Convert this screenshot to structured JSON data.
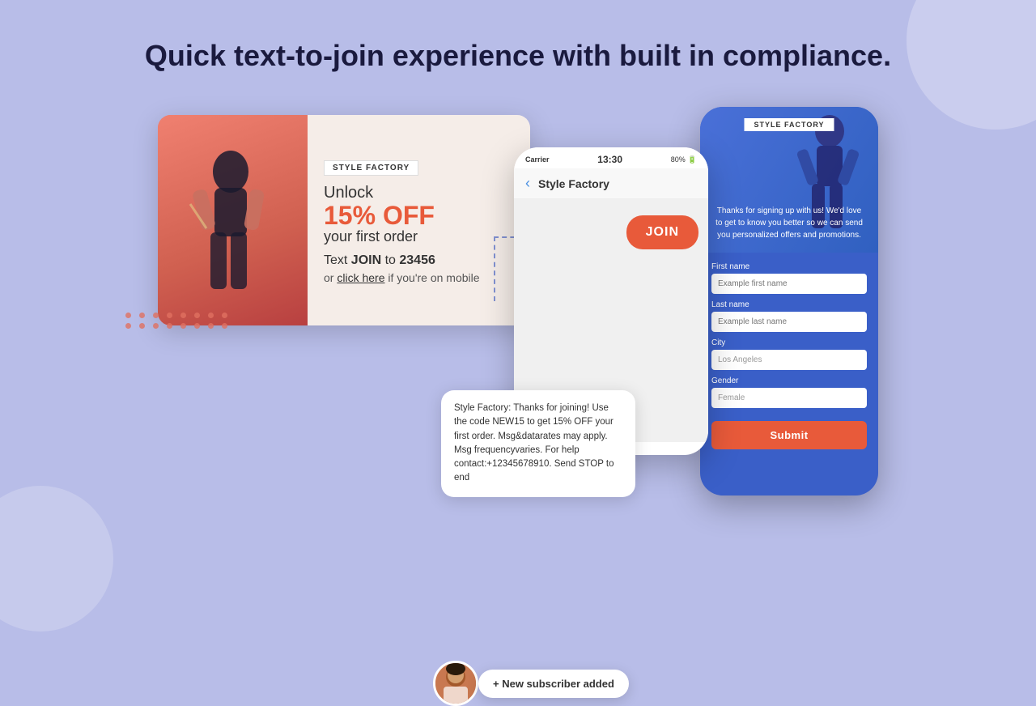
{
  "page": {
    "title": "Quick text-to-join experience with built in compliance."
  },
  "promo_card": {
    "brand": "STYLE FACTORY",
    "unlock_label": "Unlock",
    "discount": "15% OFF",
    "order_label": "your first order",
    "text_join_line": "Text JOIN to 23456",
    "mobile_line_pre": "or ",
    "click_here": "click here",
    "mobile_line_post": " if you're on mobile"
  },
  "phone": {
    "carrier": "Carrier",
    "time": "13:30",
    "battery": "80%",
    "title": "Style Factory",
    "join_button": "JOIN",
    "sms_message": "Style Factory: Thanks for joining! Use the code NEW15 to get 15% OFF your first order. Msg&datarates may apply. Msg frequencyvaries. For help contact:+12345678910. Send STOP to end"
  },
  "form_phone": {
    "brand": "STYLE FACTORY",
    "welcome_text": "Thanks for signing up with us! We'd love to get to know you better so we can send you personalized offers and promotions.",
    "fields": [
      {
        "label": "First name",
        "placeholder": "Example first name"
      },
      {
        "label": "Last name",
        "placeholder": "Example last name"
      },
      {
        "label": "City",
        "value": "Los Angeles"
      },
      {
        "label": "Gender",
        "value": "Female"
      }
    ],
    "submit_button": "Submit"
  },
  "notification": {
    "badge_text": "+ New subscriber added"
  }
}
